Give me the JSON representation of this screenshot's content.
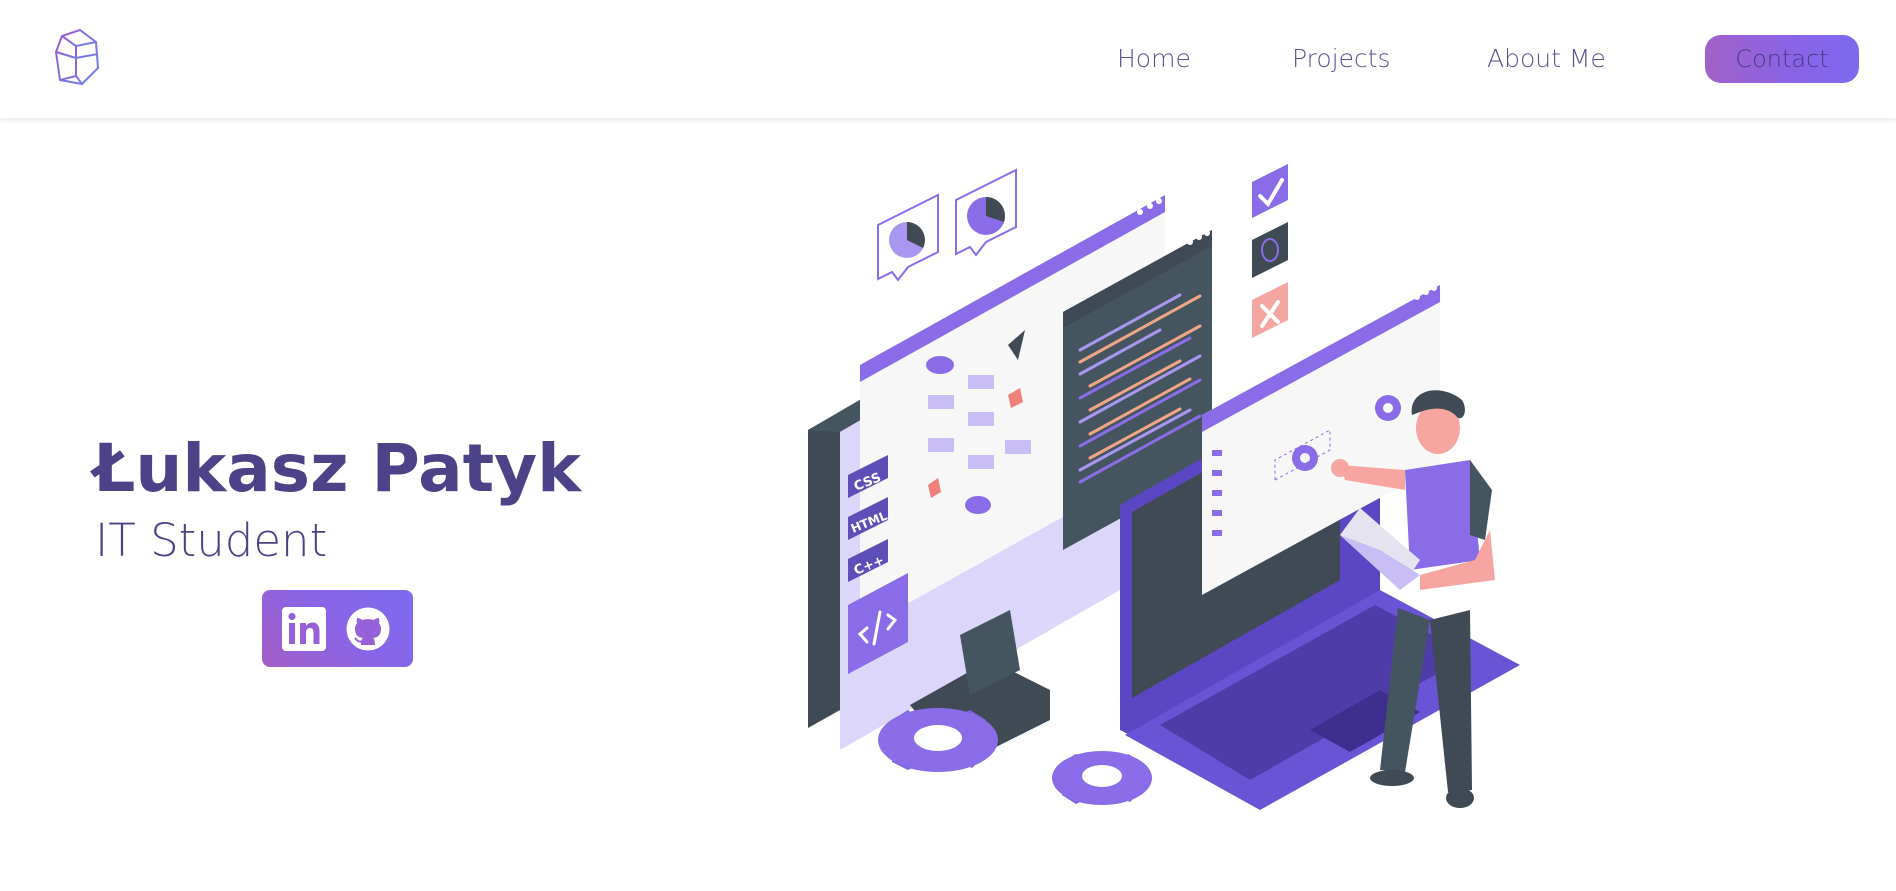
{
  "nav": {
    "links": [
      "Home",
      "Projects",
      "About Me"
    ],
    "contact_label": "Contact"
  },
  "hero": {
    "name": "Łukasz Patyk",
    "subtitle": "IT Student"
  },
  "illustration": {
    "code_tags": [
      "CSS",
      "HTML",
      "C++"
    ]
  },
  "icons": {
    "logo": "cube-logo-icon",
    "linkedin": "linkedin-icon",
    "github": "github-icon"
  },
  "colors": {
    "primary": "#4c4287",
    "accent": "#8a63e6",
    "gradient_start": "#a261c8",
    "gradient_end": "#7d69ef",
    "dark_slate": "#455560"
  }
}
